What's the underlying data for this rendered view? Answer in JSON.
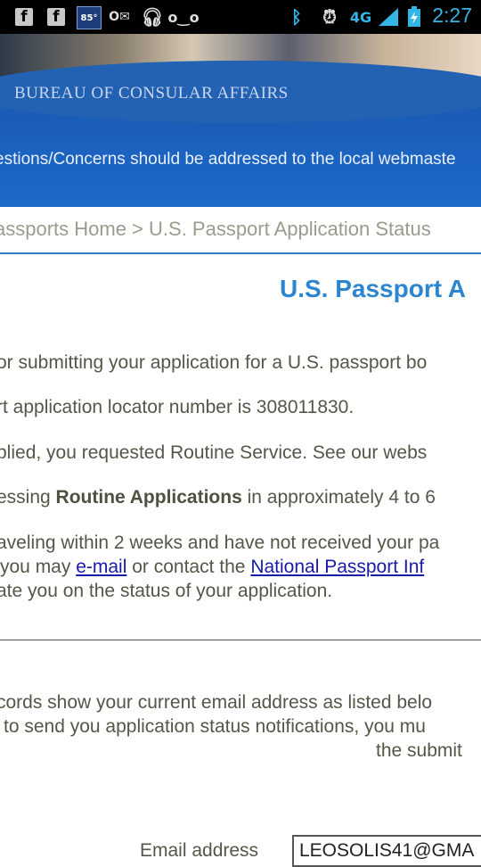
{
  "status_bar": {
    "temperature": "85°",
    "network": "4G",
    "time": "2:27",
    "icons": [
      "facebook-icon",
      "facebook-icon",
      "weather-icon",
      "outlook-icon",
      "headphones-icon",
      "voicemail-icon",
      "bluetooth-icon",
      "alarm-icon",
      "network-4g-icon",
      "signal-icon",
      "battery-charging-icon"
    ]
  },
  "header": {
    "org_name": "BUREAU OF CONSULAR AFFAIRS",
    "notice": "estions/Concerns should be addressed to the local webmaste"
  },
  "breadcrumb": "assports Home > U.S. Passport Application Status",
  "page_title": "U.S. Passport A",
  "content": {
    "line1": "or submitting your application for a U.S. passport bo",
    "line2": "rt application locator number is 308011830.",
    "line3": "plied, you requested Routine Service. See our webs",
    "line4_pre": "essing ",
    "line4_bold": "Routine Applications",
    "line4_post": " in approximately 4 to 6",
    "line5": "aveling within 2 weeks and have not received your pa",
    "line6_pre": "you may ",
    "line6_link1": "e-mail",
    "line6_mid": " or contact the ",
    "line6_link2": "National Passport Inf",
    "line7": "ate you on the status of your application."
  },
  "email_section": {
    "line1": "cords show your current email address as listed belo",
    "line2": "to send you application status notifications, you mu",
    "line3": "the submit",
    "label": "Email address",
    "value": "LEOSOLIS41@GMA"
  }
}
